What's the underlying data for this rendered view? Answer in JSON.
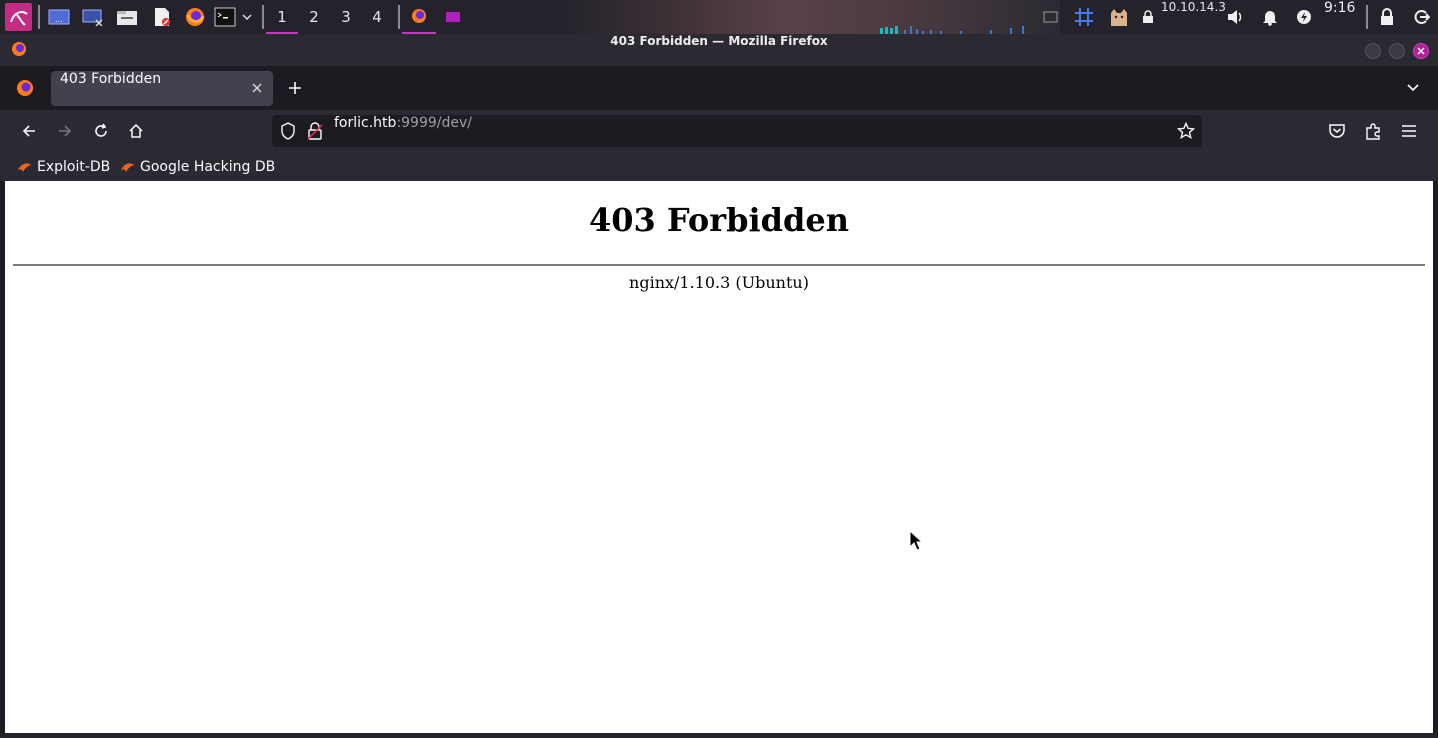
{
  "panel": {
    "workspaces": [
      "1",
      "2",
      "3",
      "4"
    ],
    "active_workspace": "1",
    "vpn_ip": "10.10.14.3",
    "clock": "9:16"
  },
  "window": {
    "title": "403 Forbidden — Mozilla Firefox"
  },
  "tabs": [
    {
      "label": "403 Forbidden"
    }
  ],
  "urlbar": {
    "host": "forlic.htb",
    "rest": ":9999/dev/"
  },
  "bookmarks": [
    {
      "label": "Exploit-DB"
    },
    {
      "label": "Google Hacking DB"
    }
  ],
  "page": {
    "heading": "403 Forbidden",
    "server": "nginx/1.10.3 (Ubuntu)"
  },
  "colors": {
    "accent": "#c03ac0",
    "panel_bg": "#24232b",
    "firefox_chrome": "#2b2a33"
  }
}
